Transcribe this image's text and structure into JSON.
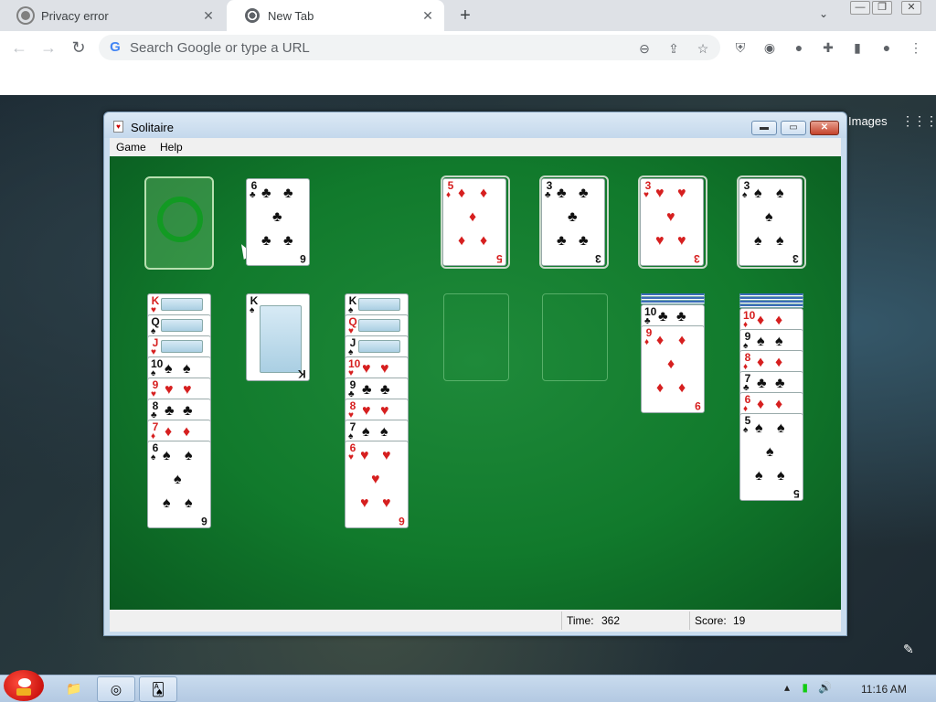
{
  "browser": {
    "tabs": [
      {
        "title": "Privacy error",
        "active": false
      },
      {
        "title": "New Tab",
        "active": true
      }
    ],
    "new_tab_glyph": "+",
    "omnibox_placeholder": "Search Google or type a URL",
    "ntp_images_link": "Images"
  },
  "solitaire": {
    "title": "Solitaire",
    "menu": [
      "Game",
      "Help"
    ],
    "status": {
      "time_label": "Time:",
      "time_value": "362",
      "score_label": "Score:",
      "score_value": "19"
    },
    "waste_card": {
      "rank": "6",
      "suit": "♣",
      "color": "black"
    },
    "foundations": [
      {
        "rank": "5",
        "suit": "♦",
        "color": "red"
      },
      {
        "rank": "3",
        "suit": "♣",
        "color": "black"
      },
      {
        "rank": "3",
        "suit": "♥",
        "color": "red"
      },
      {
        "rank": "3",
        "suit": "♠",
        "color": "black"
      }
    ],
    "tableau": [
      {
        "hidden": 0,
        "cards": [
          {
            "rank": "K",
            "suit": "♥",
            "color": "red"
          },
          {
            "rank": "Q",
            "suit": "♠",
            "color": "black"
          },
          {
            "rank": "J",
            "suit": "♥",
            "color": "red"
          },
          {
            "rank": "10",
            "suit": "♠",
            "color": "black"
          },
          {
            "rank": "9",
            "suit": "♥",
            "color": "red"
          },
          {
            "rank": "8",
            "suit": "♣",
            "color": "black"
          },
          {
            "rank": "7",
            "suit": "♦",
            "color": "red"
          },
          {
            "rank": "6",
            "suit": "♠",
            "color": "black"
          }
        ]
      },
      {
        "hidden": 0,
        "cards": [
          {
            "rank": "K",
            "suit": "♠",
            "color": "black"
          }
        ]
      },
      {
        "hidden": 0,
        "cards": [
          {
            "rank": "K",
            "suit": "♠",
            "color": "black"
          },
          {
            "rank": "Q",
            "suit": "♥",
            "color": "red"
          },
          {
            "rank": "J",
            "suit": "♠",
            "color": "black"
          },
          {
            "rank": "10",
            "suit": "♥",
            "color": "red"
          },
          {
            "rank": "9",
            "suit": "♣",
            "color": "black"
          },
          {
            "rank": "8",
            "suit": "♥",
            "color": "red"
          },
          {
            "rank": "7",
            "suit": "♠",
            "color": "black"
          },
          {
            "rank": "6",
            "suit": "♥",
            "color": "red"
          }
        ]
      },
      {
        "hidden": 0,
        "cards": []
      },
      {
        "hidden": 0,
        "cards": []
      },
      {
        "hidden": 3,
        "cards": [
          {
            "rank": "10",
            "suit": "♣",
            "color": "black"
          },
          {
            "rank": "9",
            "suit": "♦",
            "color": "red"
          }
        ]
      },
      {
        "hidden": 4,
        "cards": [
          {
            "rank": "10",
            "suit": "♦",
            "color": "red"
          },
          {
            "rank": "9",
            "suit": "♠",
            "color": "black"
          },
          {
            "rank": "8",
            "suit": "♦",
            "color": "red"
          },
          {
            "rank": "7",
            "suit": "♣",
            "color": "black"
          },
          {
            "rank": "6",
            "suit": "♦",
            "color": "red"
          },
          {
            "rank": "5",
            "suit": "♠",
            "color": "black"
          }
        ]
      }
    ]
  },
  "taskbar": {
    "clock": "11:16 AM",
    "items": [
      "angry-bird-start-icon",
      "explorer-icon",
      "chrome-icon",
      "solitaire-icon"
    ]
  },
  "colors": {
    "felt": "#117a2c",
    "red_suit": "#d61f1f",
    "black_suit": "#111111"
  }
}
